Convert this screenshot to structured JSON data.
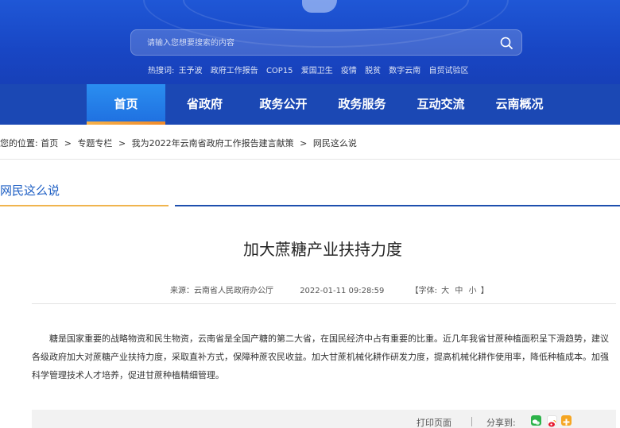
{
  "search": {
    "placeholder": "请输入您想要搜索的内容"
  },
  "hot_search": {
    "label": "热搜词:",
    "terms": [
      "王予波",
      "政府工作报告",
      "COP15",
      "爱国卫生",
      "疫情",
      "脱贫",
      "数字云南",
      "自贸试验区"
    ]
  },
  "nav": {
    "items": [
      "首页",
      "省政府",
      "政务公开",
      "政务服务",
      "互动交流",
      "云南概况"
    ]
  },
  "breadcrumb": {
    "prefix": "您的位置:",
    "items": [
      "首页",
      "专题专栏",
      "我为2022年云南省政府工作报告建言献策",
      "网民这么说"
    ]
  },
  "section": {
    "title": "网民这么说"
  },
  "article": {
    "title": "加大蔗糖产业扶持力度",
    "source": "来源：云南省人民政府办公厅",
    "date": "2022-01-11 09:28:59",
    "font_label_open": "【字体:",
    "font_sizes": [
      "大",
      "中",
      "小"
    ],
    "font_label_close": "】",
    "body": "糖是国家重要的战略物资和民生物资，云南省是全国产糖的第二大省，在国民经济中占有重要的比重。近几年我省甘蔗种植面积呈下滑趋势，建议各级政府加大对蔗糖产业扶持力度，采取直补方式，保障种蔗农民收益。加大甘蔗机械化耕作研发力度，提高机械化耕作使用率，降低种植成本。加强科学管理技术人才培养，促进甘蔗种植精细管理。"
  },
  "footer": {
    "print_label": "打印页面",
    "share_label": "分享到:"
  },
  "colors": {
    "header_blue": "#1f57d6",
    "nav_blue": "#1b48b4",
    "accent_orange": "#f0b44e",
    "link_blue": "#1e5fc4"
  }
}
